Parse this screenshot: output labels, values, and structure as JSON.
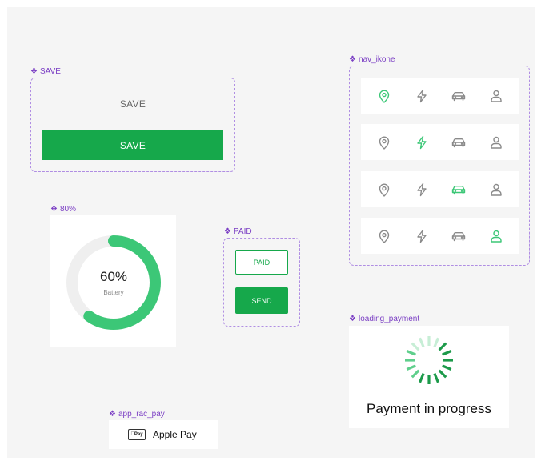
{
  "frames": {
    "save": {
      "label": "SAVE",
      "ghost_text": "SAVE",
      "primary_text": "SAVE"
    },
    "nav": {
      "label": "nav_ikone",
      "icons": [
        "location-pin-icon",
        "lightning-icon",
        "car-icon",
        "user-icon"
      ],
      "active_per_row": [
        0,
        1,
        2,
        3
      ]
    },
    "battery": {
      "label": "80%",
      "value_text": "60%",
      "sub_text": "Battery",
      "progress": 0.6
    },
    "paid": {
      "label": "PAID",
      "paid_text": "PAID",
      "send_text": "SEND"
    },
    "loading": {
      "label": "loading_payment",
      "text": "Payment in progress"
    },
    "applepay": {
      "label": "app_rac_pay",
      "mark_text": "Pay",
      "text": "Apple Pay"
    }
  },
  "colors": {
    "accent": "#16a84b",
    "accent_light": "#3cc777",
    "frame_label": "#7b3fc4",
    "dashed_border": "#b08ee3",
    "icon_inactive": "#8a8a8a",
    "track": "#efefef"
  }
}
